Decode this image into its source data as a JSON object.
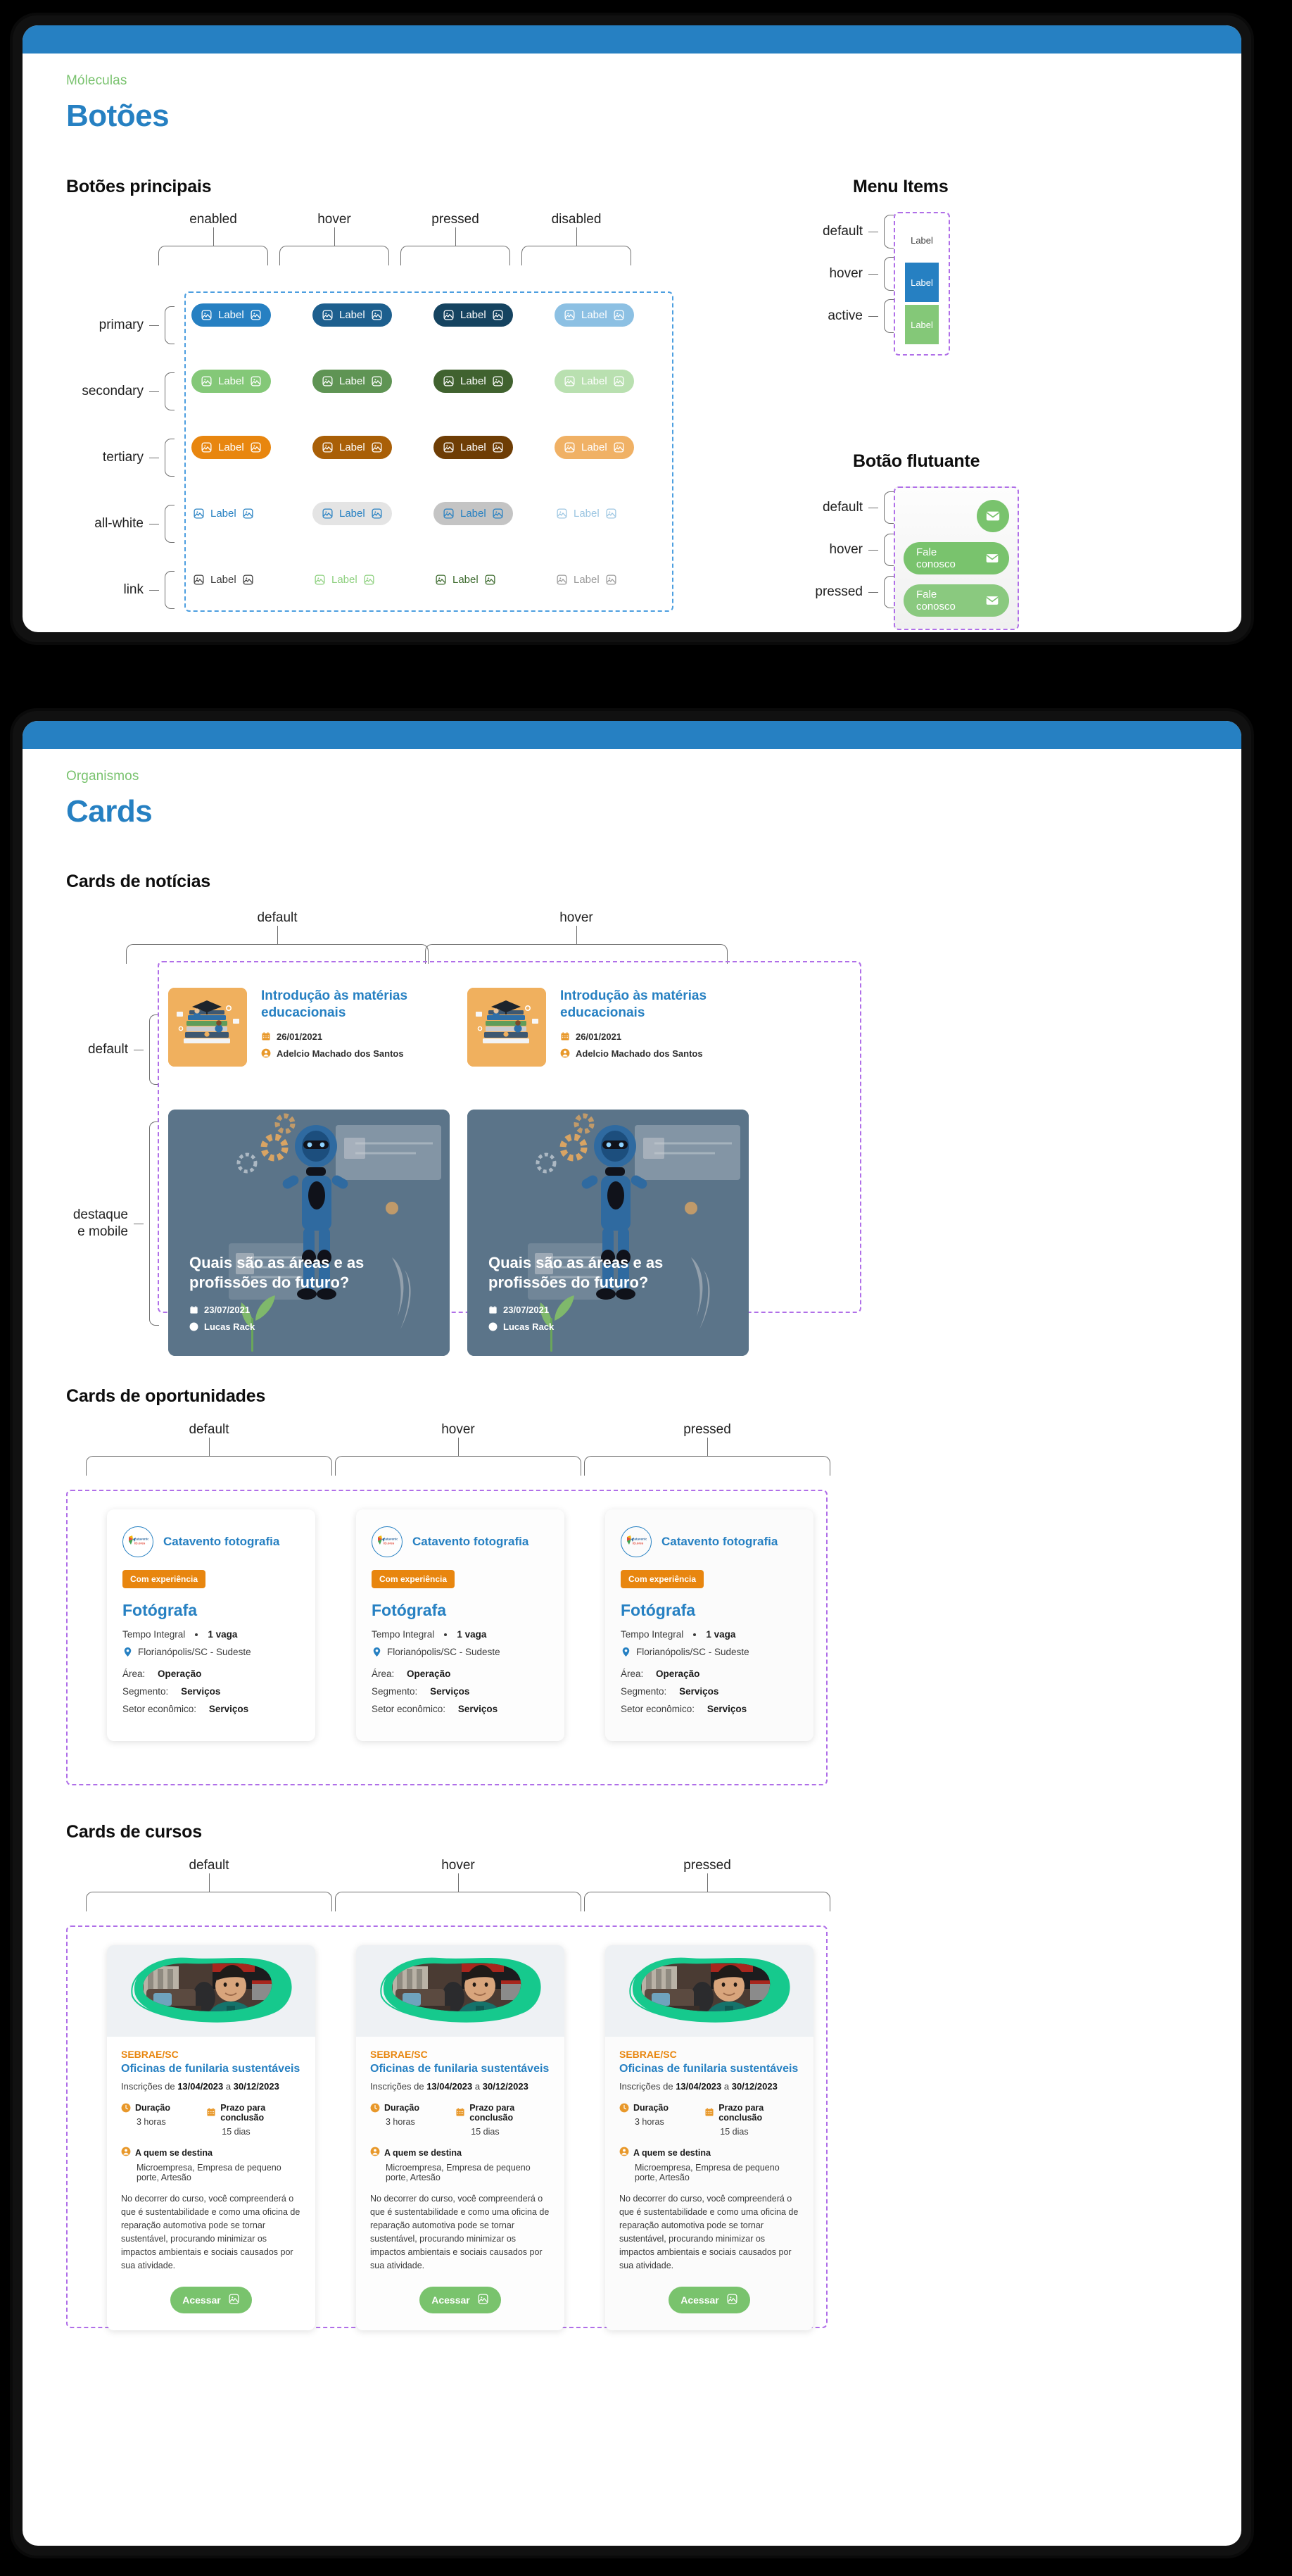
{
  "colors": {
    "brand_blue": "#2680c2",
    "brand_green": "#79c36d",
    "brand_orange": "#e8860f",
    "eyebrow_green": "#7ac36f",
    "topbar": "#2680c2"
  },
  "botoes_screen": {
    "eyebrow": "Móleculas",
    "title": "Botões",
    "sections": {
      "principais": {
        "title": "Botões principais",
        "columns": [
          "enabled",
          "hover",
          "pressed",
          "disabled"
        ],
        "rows": [
          "primary",
          "secondary",
          "tertiary",
          "all-white",
          "link"
        ],
        "button_label": "Label",
        "icon": "image-icon",
        "styles": {
          "primary": [
            {
              "bg": "#2680c2",
              "fg": "#ffffff"
            },
            {
              "bg": "#1d5f8e",
              "fg": "#ffffff"
            },
            {
              "bg": "#154360",
              "fg": "#ffffff"
            },
            {
              "bg": "#8cc0e3",
              "fg": "#ffffff"
            }
          ],
          "secondary": [
            {
              "bg": "#84c878",
              "fg": "#ffffff"
            },
            {
              "bg": "#5f9454",
              "fg": "#ffffff"
            },
            {
              "bg": "#40622f",
              "fg": "#ffffff"
            },
            {
              "bg": "#b9e0b0",
              "fg": "#ffffff"
            }
          ],
          "tertiary": [
            {
              "bg": "#e8860f",
              "fg": "#ffffff"
            },
            {
              "bg": "#a95f07",
              "fg": "#ffffff"
            },
            {
              "bg": "#6e3d05",
              "fg": "#ffffff"
            },
            {
              "bg": "#f0b165",
              "fg": "#ffffff"
            }
          ],
          "all-white": [
            {
              "bg": "transparent",
              "fg": "#2680c2"
            },
            {
              "bg": "#e4e4e4",
              "fg": "#2680c2"
            },
            {
              "bg": "#c4c4c4",
              "fg": "#2680c2"
            },
            {
              "bg": "transparent",
              "fg": "#9dc6e2"
            }
          ],
          "link": [
            {
              "bg": "transparent",
              "fg": "#3c3c3c"
            },
            {
              "bg": "transparent",
              "fg": "#8ed07f"
            },
            {
              "bg": "transparent",
              "fg": "#3d6b2e"
            },
            {
              "bg": "transparent",
              "fg": "#9b9b9b"
            }
          ]
        }
      },
      "menu_items": {
        "title": "Menu Items",
        "rows": [
          "default",
          "hover",
          "active"
        ],
        "item_label": "Label",
        "styles": [
          {
            "bg": "transparent",
            "fg": "#3c3c3c"
          },
          {
            "bg": "#2680c2",
            "fg": "#ffffff"
          },
          {
            "bg": "#84c878",
            "fg": "#ffffff"
          }
        ]
      },
      "botao_flutuante": {
        "title": "Botão flutuante",
        "rows": [
          "default",
          "hover",
          "pressed"
        ],
        "label": "Fale conosco",
        "icon": "envelope-icon",
        "styles": [
          {
            "bg": "#79c36d",
            "expanded": false
          },
          {
            "bg": "#79c36d",
            "expanded": true
          },
          {
            "bg": "#8ac97f",
            "expanded": true
          }
        ]
      }
    }
  },
  "cards_screen": {
    "eyebrow": "Organismos",
    "title": "Cards",
    "news": {
      "title": "Cards de notícias",
      "columns": [
        "default",
        "hover"
      ],
      "rows": [
        "default",
        "destaque\ne mobile"
      ],
      "default_card": {
        "title": "Introdução às matérias educacionais",
        "date": "26/01/2021",
        "author": "Adelcio Machado dos Santos",
        "date_icon": "calendar-icon",
        "author_icon": "user-icon",
        "thumb": "graduation-books-illustration"
      },
      "highlight_card": {
        "title": "Quais são as áreas e as profissões do futuro?",
        "date": "23/07/2021",
        "author": "Lucas Rack",
        "date_icon": "calendar-icon",
        "author_icon": "user-icon",
        "image": "robot-illustration"
      }
    },
    "opportunities": {
      "title": "Cards de oportunidades",
      "columns": [
        "default",
        "hover",
        "pressed"
      ],
      "card": {
        "company": "Catavento fotografia",
        "logo": "catavento-logo",
        "badge": "Com experiência",
        "role": "Fotógrafa",
        "contract": "Tempo Integral",
        "vacancies": "1 vaga",
        "location": "Florianópolis/SC - Sudeste",
        "location_icon": "map-pin-icon",
        "fields": [
          {
            "label": "Área:",
            "value": "Operação"
          },
          {
            "label": "Segmento:",
            "value": "Serviços"
          },
          {
            "label": "Setor econômico:",
            "value": "Serviços"
          }
        ]
      }
    },
    "courses": {
      "title": "Cards de cursos",
      "columns": [
        "default",
        "hover",
        "pressed"
      ],
      "card": {
        "image": "mechanic-photo",
        "org": "SEBRAE/SC",
        "name": "Oficinas de funilaria sustentáveis",
        "enrollment_prefix": "Inscrições de ",
        "enrollment_start": "13/04/2023",
        "enrollment_mid": " a ",
        "enrollment_end": "30/12/2023",
        "duration_label": "Duração",
        "duration_icon": "clock-icon",
        "duration_value": "3 horas",
        "deadline_label": "Prazo para conclusão",
        "deadline_icon": "calendar-icon",
        "deadline_value": "15 dias",
        "audience_label": "A quem se destina",
        "audience_icon": "user-icon",
        "audience_value": "Microempresa, Empresa de pequeno porte, Artesão",
        "description": "No decorrer do curso, você compreenderá o que é sustentabilidade e como uma oficina de reparação automotiva pode se tornar sustentável, procurando minimizar os impactos ambientais e sociais causados por sua atividade.",
        "cta": "Acessar",
        "cta_icon": "image-icon"
      }
    }
  }
}
